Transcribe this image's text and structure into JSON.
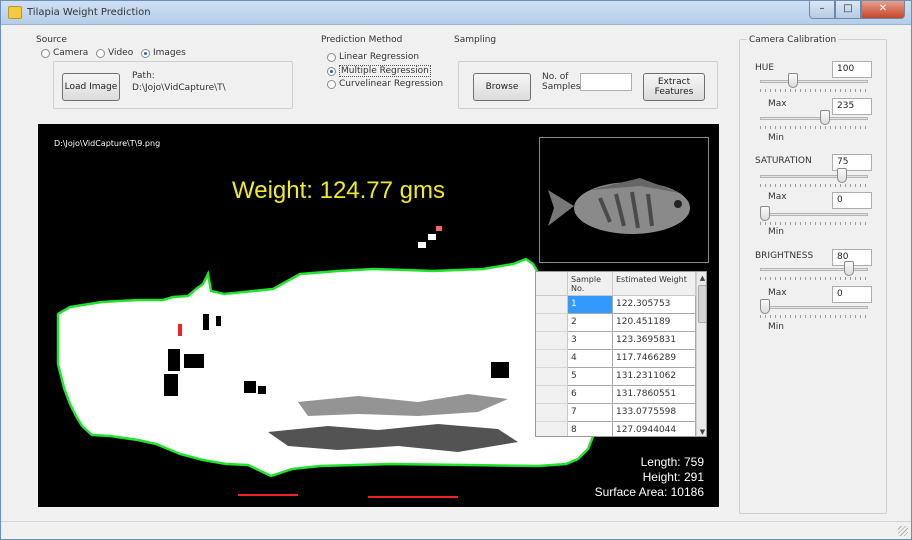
{
  "window": {
    "title": "Tilapia Weight Prediction",
    "controls": [
      "–",
      "□",
      "✕"
    ]
  },
  "source": {
    "label": "Source",
    "options": [
      {
        "label": "Camera",
        "selected": false
      },
      {
        "label": "Video",
        "selected": false
      },
      {
        "label": "Images",
        "selected": true
      }
    ],
    "load_button": "Load Image",
    "path_label": "Path:",
    "path_value": "D:\\Jojo\\VidCapture\\T\\"
  },
  "prediction": {
    "label": "Prediction Method",
    "options": [
      {
        "label": "Linear Regression",
        "selected": false
      },
      {
        "label": "Multiple Regression",
        "selected": true
      },
      {
        "label": "Curvelinear Regression",
        "selected": false
      }
    ]
  },
  "sampling": {
    "label": "Sampling",
    "browse_button": "Browse",
    "samples_label_1": "No. of",
    "samples_label_2": "Samples",
    "samples_value": "",
    "extract_button_1": "Extract",
    "extract_button_2": "Features"
  },
  "display": {
    "file_path": "D:\\Jojo\\VidCapture\\T\\9.png",
    "weight": "Weight: 124.77 gms",
    "length": "Length: 759",
    "height": "Height: 291",
    "surface_area": "Surface Area: 10186",
    "outline_color": "#22e22e",
    "weight_color": "#f0ea2a"
  },
  "grid": {
    "col1": "Sample No.",
    "col2": "Estimated Weight",
    "rows": [
      {
        "no": "1",
        "weight": "122.305753"
      },
      {
        "no": "2",
        "weight": "120.451189"
      },
      {
        "no": "3",
        "weight": "123.3695831"
      },
      {
        "no": "4",
        "weight": "117.7466289"
      },
      {
        "no": "5",
        "weight": "131.2311062"
      },
      {
        "no": "6",
        "weight": "131.7860551"
      },
      {
        "no": "7",
        "weight": "133.0775598"
      },
      {
        "no": "8",
        "weight": "127.0944044"
      }
    ],
    "selected_row": 0
  },
  "calibration": {
    "label": "Camera Calibration",
    "hue": {
      "label": "HUE",
      "max_value": "100",
      "max_label": "Max",
      "min_value": "235",
      "min_label": "Min"
    },
    "saturation": {
      "label": "SATURATION",
      "max_value": "75",
      "max_label": "Max",
      "min_value": "0",
      "min_label": "Min"
    },
    "brightness": {
      "label": "BRIGHTNESS",
      "max_value": "80",
      "max_label": "Max",
      "min_value": "0",
      "min_label": "Min"
    }
  }
}
